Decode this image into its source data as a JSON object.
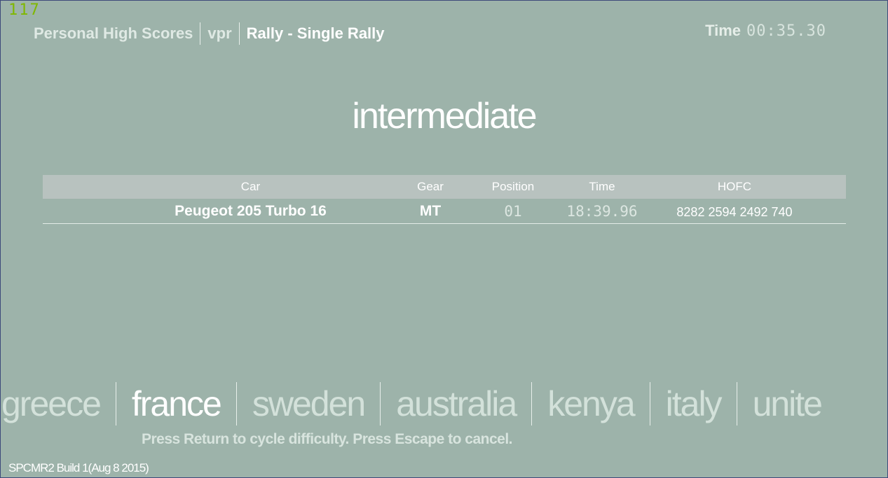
{
  "fps_counter": "117",
  "breadcrumb": {
    "items": [
      "Personal High Scores",
      "vpr",
      "Rally - Single Rally"
    ]
  },
  "timer": {
    "label": "Time",
    "value": "00:35.30"
  },
  "difficulty": "intermediate",
  "scores_table": {
    "headers": {
      "car": "Car",
      "gear": "Gear",
      "position": "Position",
      "time": "Time",
      "hofc": "HOFC"
    },
    "rows": [
      {
        "car": "Peugeot 205 Turbo 16",
        "gear": "MT",
        "position": "01",
        "time": "18:39.96",
        "hofc": "8282 2594 2492 740"
      }
    ]
  },
  "countries": {
    "items": [
      "greece",
      "france",
      "sweden",
      "australia",
      "kenya",
      "italy",
      "unite"
    ],
    "selected": "france"
  },
  "hint": "Press Return to cycle difficulty.  Press Escape to cancel.",
  "build_info": "SPCMR2 Build 1(Aug  8 2015)",
  "colors": {
    "background": "#9db3aa",
    "header_bar": "#b8c2bf",
    "fps_counter": "#7fb800",
    "text": "#ffffff"
  }
}
